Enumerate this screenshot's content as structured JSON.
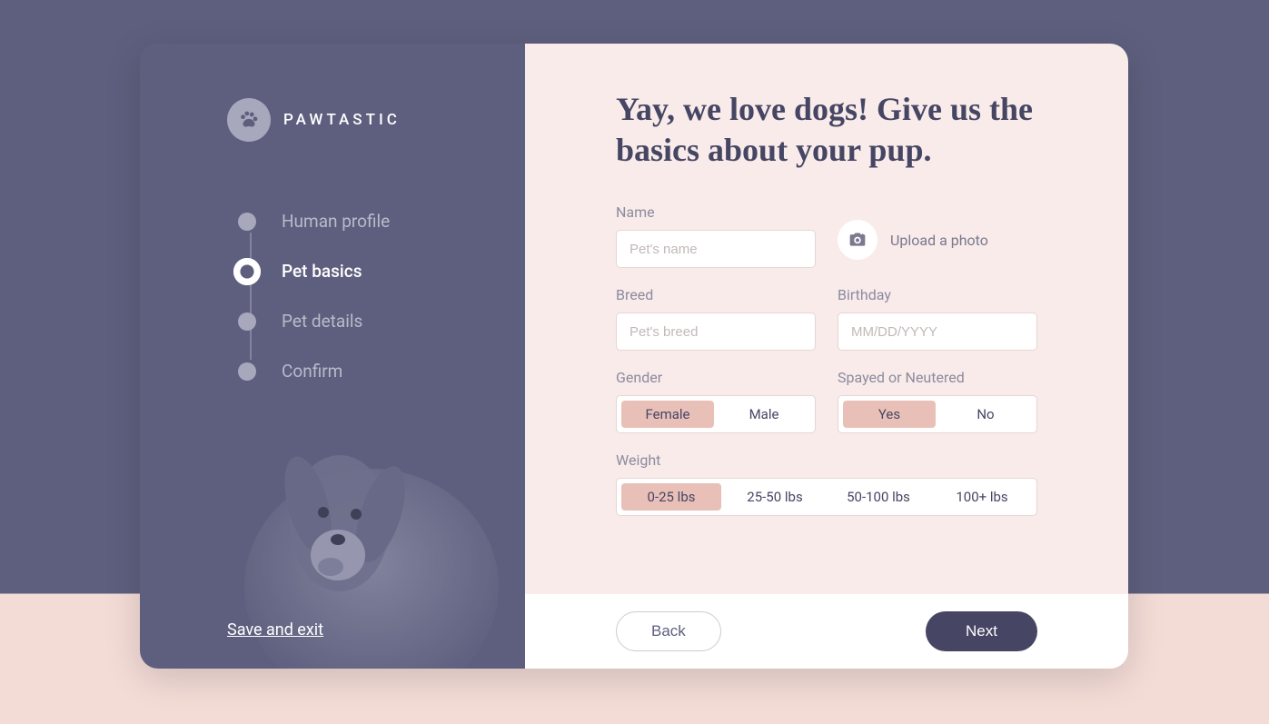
{
  "brand": {
    "name": "PAWTASTIC"
  },
  "sidebar": {
    "steps": [
      {
        "label": "Human profile",
        "active": false
      },
      {
        "label": "Pet basics",
        "active": true
      },
      {
        "label": "Pet details",
        "active": false
      },
      {
        "label": "Confirm",
        "active": false
      }
    ],
    "save_exit": "Save and exit"
  },
  "main": {
    "heading": "Yay, we love dogs! Give us the basics about your pup.",
    "name_label": "Name",
    "name_placeholder": "Pet's name",
    "upload_label": "Upload a photo",
    "breed_label": "Breed",
    "breed_placeholder": "Pet's breed",
    "birthday_label": "Birthday",
    "birthday_placeholder": "MM/DD/YYYY",
    "gender_label": "Gender",
    "gender_options": {
      "female": "Female",
      "male": "Male"
    },
    "gender_selected": "female",
    "neutered_label": "Spayed or Neutered",
    "neutered_options": {
      "yes": "Yes",
      "no": "No"
    },
    "neutered_selected": "yes",
    "weight_label": "Weight",
    "weight_options": [
      "0-25 lbs",
      "25-50 lbs",
      "50-100 lbs",
      "100+ lbs"
    ],
    "weight_selected": 0
  },
  "footer": {
    "back": "Back",
    "next": "Next"
  },
  "colors": {
    "accent": "#e9c0b8",
    "dark": "#464664",
    "panel": "#5e5f7e",
    "bg": "#f8ebe9"
  }
}
